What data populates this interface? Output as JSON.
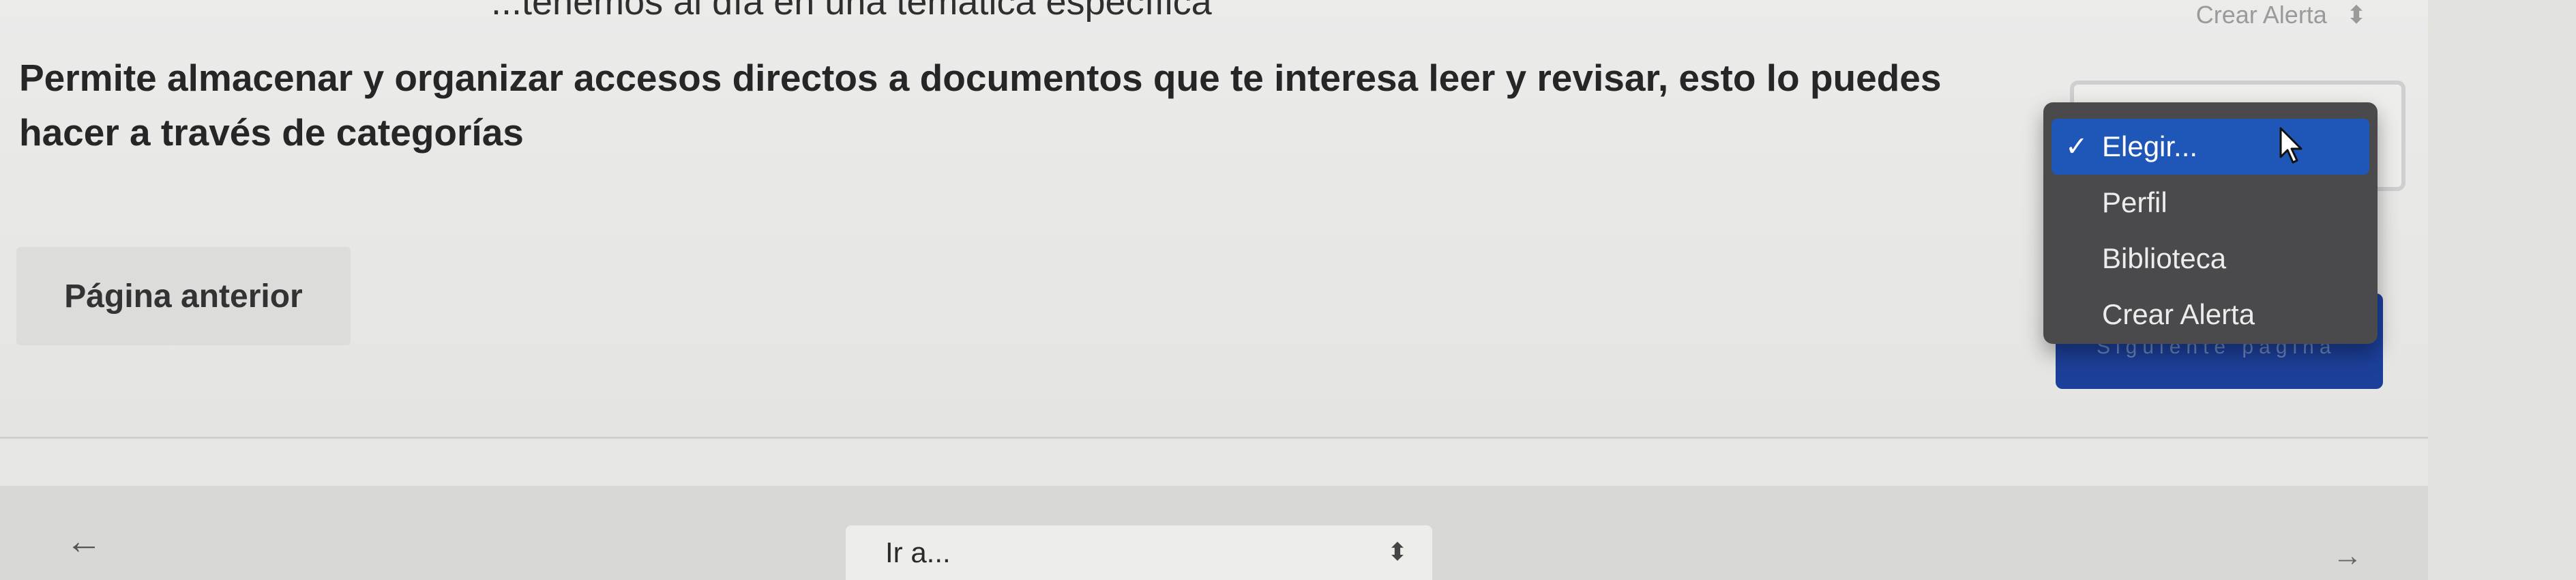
{
  "header": {
    "top_text": "...tenemos al día en una temática específica"
  },
  "content": {
    "description": "Permite almacenar y organizar accesos directos a documentos que te interesa leer y revisar, esto lo puedes hacer a través de categorías"
  },
  "buttons": {
    "previous_page": "Página anterior",
    "next_page": "Siguiente página"
  },
  "top_select": {
    "value": "Crear Alerta",
    "arrows": "⬍"
  },
  "dropdown": {
    "options": [
      {
        "label": "Elegir...",
        "selected": true,
        "check": "✓"
      },
      {
        "label": "Perfil",
        "selected": false
      },
      {
        "label": "Biblioteca",
        "selected": false
      },
      {
        "label": "Crear Alerta",
        "selected": false
      }
    ]
  },
  "footer": {
    "back_arrow": "←",
    "goto_label": "Ir a...",
    "goto_arrows": "⬍",
    "forward_arrow": "→"
  },
  "colors": {
    "accent_blue": "#1e57b8",
    "dropdown_bg": "#4a4a4c",
    "next_button": "#1c3f99"
  }
}
